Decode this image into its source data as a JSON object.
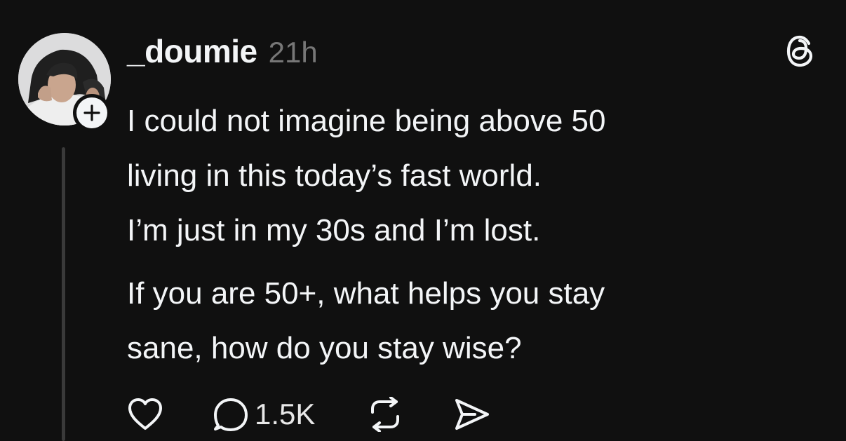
{
  "post": {
    "author": {
      "username": "_doumie",
      "timestamp": "21h"
    },
    "text": {
      "paragraph1": [
        "I could not imagine being above 50",
        "living in this today’s fast world.",
        "I’m just in my 30s and I’m lost."
      ],
      "paragraph2": [
        "If you are 50+, what helps you stay",
        "sane, how do you stay wise?"
      ]
    },
    "actions": {
      "like": {
        "icon": "heart-icon"
      },
      "reply": {
        "icon": "speech-bubble-icon",
        "count": "1.5K"
      },
      "repost": {
        "icon": "repost-icon"
      },
      "share": {
        "icon": "send-icon"
      }
    },
    "icons": {
      "brand": "threads-logo-icon",
      "follow": "plus-icon"
    },
    "colors": {
      "background": "#101010",
      "text": "#f3f5f7",
      "secondary_text": "#777777",
      "thread_line": "#3a3a3a"
    }
  }
}
